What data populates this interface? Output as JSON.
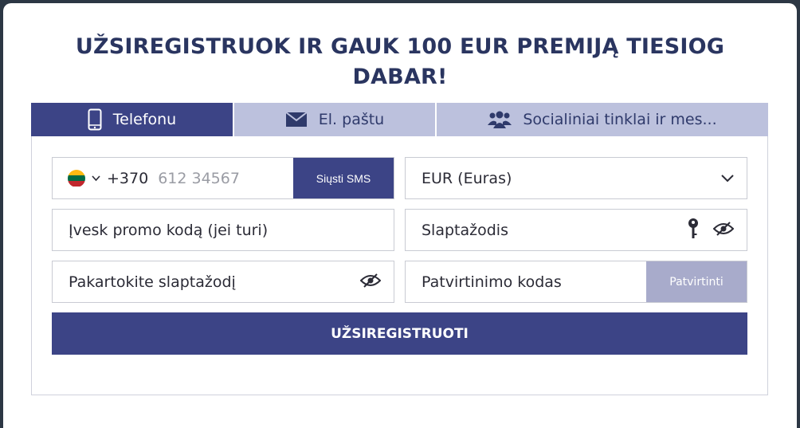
{
  "title": {
    "line1": "UŽSIREGISTRUOK IR GAUK 100 EUR PREMIJĄ TIESIOG",
    "line2": "DABAR!"
  },
  "tabs": [
    {
      "label": "Telefonu",
      "icon": "phone-icon",
      "active": true
    },
    {
      "label": "El. paštu",
      "icon": "envelope-icon",
      "active": false
    },
    {
      "label": "Socialiniai tinklai ir mes...",
      "icon": "users-icon",
      "active": false
    }
  ],
  "form": {
    "phone": {
      "country_flag": "lithuania-flag-icon",
      "prefix": "+370",
      "placeholder": "612 34567",
      "send_sms_label": "Siųsti SMS"
    },
    "currency": {
      "selected": "EUR (Euras)"
    },
    "promo": {
      "placeholder": "Įvesk promo kodą (jei turi)"
    },
    "password": {
      "placeholder": "Slaptažodis"
    },
    "repeat_password": {
      "placeholder": "Pakartokite slaptažodį"
    },
    "confirmation_code": {
      "placeholder": "Patvirtinimo kodas",
      "confirm_label": "Patvirtinti"
    },
    "register_label": "UŽSIREGISTRUOTI"
  },
  "colors": {
    "accent": "#3c4486",
    "tab_inactive": "#bcc1dd",
    "title": "#2a3560",
    "confirm_disabled": "#a8abcb",
    "flag_yellow": "#fdb913",
    "flag_green": "#006a44",
    "flag_red": "#c1272d"
  }
}
